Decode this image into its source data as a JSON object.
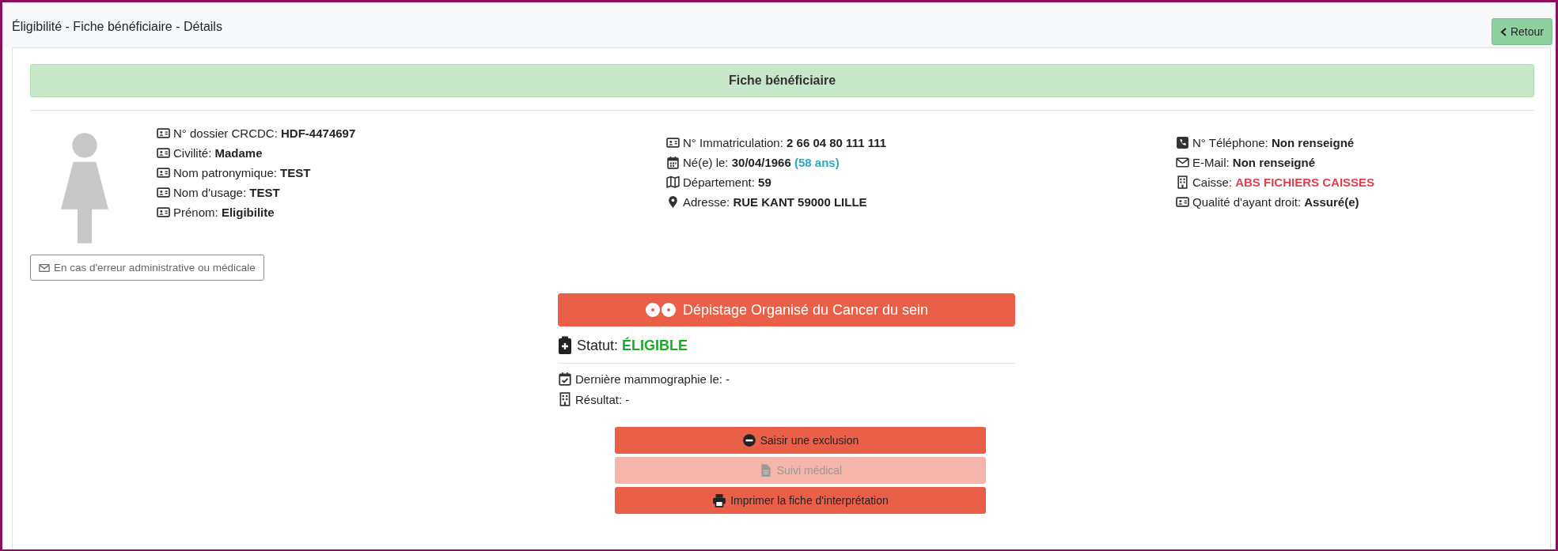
{
  "header": {
    "title": "Éligibilité - Fiche bénéficiaire - Détails",
    "back_button": "Retour"
  },
  "section_title": "Fiche bénéficiaire",
  "identity": [
    {
      "kind": "id",
      "label": "N° dossier CRCDC:",
      "value": "HDF-4474697"
    },
    {
      "kind": "id",
      "label": "Civilité:",
      "value": "Madame"
    },
    {
      "kind": "id",
      "label": "Nom patronymique:",
      "value": "TEST"
    },
    {
      "kind": "id",
      "label": "Nom d'usage:",
      "value": "TEST"
    },
    {
      "kind": "id",
      "label": "Prénom:",
      "value": "Eligibilite"
    }
  ],
  "report_button": "En cas d'erreur administrative ou médicale",
  "civil": [
    {
      "kind": "id",
      "label": "N° Immatriculation:",
      "value": "2 66 04 80 111 111"
    },
    {
      "kind": "calendar",
      "label": "Né(e) le:",
      "value": "30/04/1966",
      "note": "(58 ans)"
    },
    {
      "kind": "map",
      "label": "Département:",
      "value": "59"
    },
    {
      "kind": "pin",
      "label": "Adresse:",
      "value": "RUE KANT 59000 LILLE"
    }
  ],
  "contact": [
    {
      "kind": "phone",
      "label": "N° Téléphone:",
      "value": "Non renseigné"
    },
    {
      "kind": "mail",
      "label": "E-Mail:",
      "value": "Non renseigné"
    },
    {
      "kind": "building",
      "label": "Caisse:",
      "value": "ABS FICHIERS CAISSES",
      "color": "#e0404f"
    },
    {
      "kind": "id",
      "label": "Qualité d'ayant droit:",
      "value": "Assuré(e)"
    }
  ],
  "screening": {
    "title": "Dépistage Organisé du Cancer du sein",
    "status_label": "Statut:",
    "status": "ÉLIGIBLE",
    "details": [
      {
        "kind": "calendar-check",
        "text": "Dernière mammographie le: -"
      },
      {
        "kind": "building",
        "text": "Résultat: -"
      }
    ],
    "actions": [
      {
        "kind": "minus",
        "label": "Saisir une exclusion",
        "disabled": false
      },
      {
        "kind": "file",
        "label": "Suivi médical",
        "disabled": true
      },
      {
        "kind": "print",
        "label": "Imprimer la fiche d'interprétation",
        "disabled": false
      }
    ]
  }
}
